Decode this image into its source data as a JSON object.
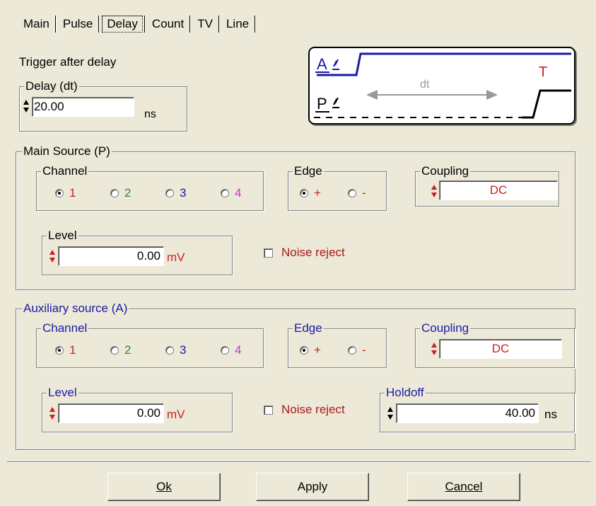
{
  "tabs": [
    "Main",
    "Pulse",
    "Delay",
    "Count",
    "TV",
    "Line"
  ],
  "active_tab": "Delay",
  "trigger_label": "Trigger after delay",
  "delay_group": {
    "label": "Delay (dt)",
    "value": "20.00",
    "unit": "ns"
  },
  "diagram": {
    "a_label": "A",
    "p_label": "P",
    "dt_label": "dt",
    "t_label": "T"
  },
  "main_source": {
    "label": "Main Source (P)",
    "channel": {
      "label": "Channel",
      "options": [
        "1",
        "2",
        "3",
        "4"
      ],
      "selected": "1"
    },
    "edge": {
      "label": "Edge",
      "options": [
        "+",
        "-"
      ],
      "selected": "+"
    },
    "coupling": {
      "label": "Coupling",
      "value": "DC"
    },
    "level": {
      "label": "Level",
      "value": "0.00",
      "unit": "mV"
    },
    "noise_reject": {
      "label": "Noise reject",
      "checked": false
    }
  },
  "aux_source": {
    "label": "Auxiliary source (A)",
    "channel": {
      "label": "Channel",
      "options": [
        "1",
        "2",
        "3",
        "4"
      ],
      "selected": "1"
    },
    "edge": {
      "label": "Edge",
      "options": [
        "+",
        "-"
      ],
      "selected": "+"
    },
    "coupling": {
      "label": "Coupling",
      "value": "DC"
    },
    "level": {
      "label": "Level",
      "value": "0.00",
      "unit": "mV"
    },
    "noise_reject": {
      "label": "Noise reject",
      "checked": false
    },
    "holdoff": {
      "label": "Holdoff",
      "value": "40.00",
      "unit": "ns"
    }
  },
  "buttons": {
    "ok": "Ok",
    "apply": "Apply",
    "cancel": "Cancel"
  },
  "colors": {
    "channel_1": "#cc2020",
    "channel_2": "#2e8b2e",
    "channel_3": "#1a1aa6",
    "channel_4": "#cc33cc",
    "edge": "#cc2020",
    "coupling_text": "#cc2020",
    "level_unit": "#cc2020",
    "noise_reject": "#aa1a1a",
    "aux_group_label": "#1a1aa6"
  }
}
